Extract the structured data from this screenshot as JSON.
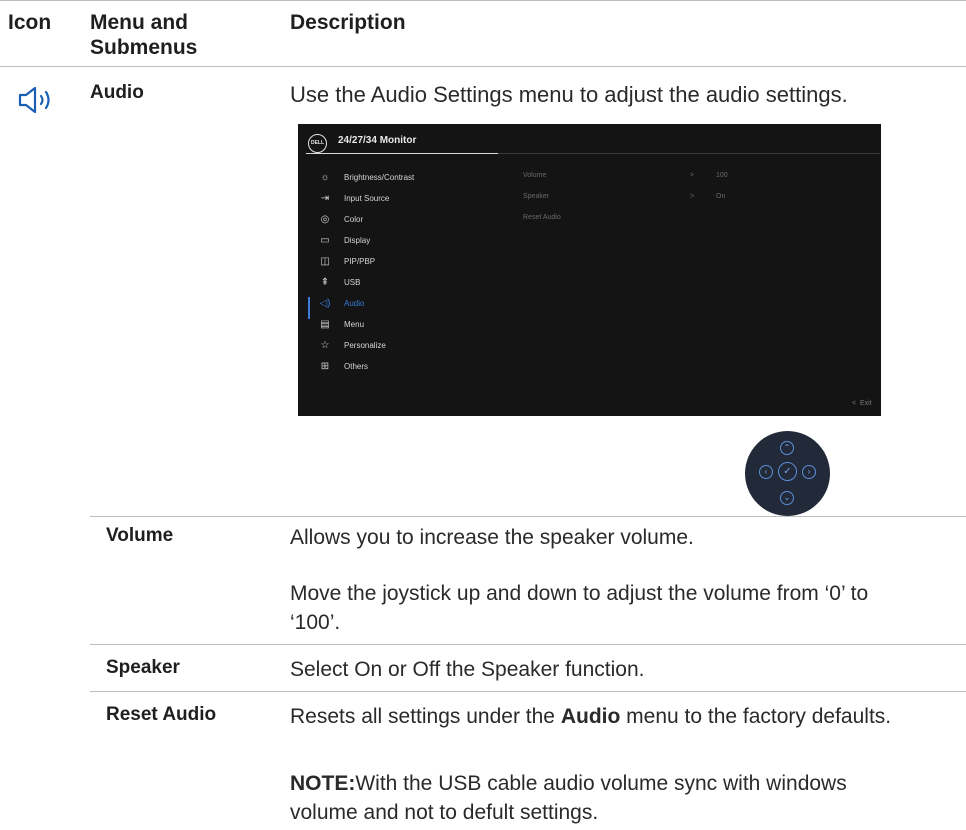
{
  "header": {
    "col_icon": "Icon",
    "col_menu_line1": "Menu and",
    "col_menu_line2": "Submenus",
    "col_desc": "Description"
  },
  "audio_row": {
    "menu_label": "Audio",
    "description": "Use the Audio Settings menu to adjust the audio settings."
  },
  "osd": {
    "logo_text": "DELL",
    "title": "24/27/34 Monitor",
    "menu_items": [
      {
        "label": "Brightness/Contrast",
        "icon": "brightness-icon"
      },
      {
        "label": "Input Source",
        "icon": "input-source-icon"
      },
      {
        "label": "Color",
        "icon": "color-icon"
      },
      {
        "label": "Display",
        "icon": "display-icon"
      },
      {
        "label": "PIP/PBP",
        "icon": "pip-pbp-icon"
      },
      {
        "label": "USB",
        "icon": "usb-icon"
      },
      {
        "label": "Audio",
        "icon": "audio-icon"
      },
      {
        "label": "Menu",
        "icon": "menu-icon"
      },
      {
        "label": "Personalize",
        "icon": "star-icon"
      },
      {
        "label": "Others",
        "icon": "others-icon"
      }
    ],
    "active_item": "Audio",
    "sub_items": [
      {
        "label": "Volume",
        "arrow": ">",
        "value": "100"
      },
      {
        "label": "Speaker",
        "arrow": ">",
        "value": "On"
      },
      {
        "label": "Reset Audio",
        "arrow": "",
        "value": ""
      }
    ],
    "exit_label": "Exit",
    "exit_arrow": "<",
    "accent_color": "#3a7bd5"
  },
  "joystick": {
    "icons": [
      "up-arrow-icon",
      "left-arrow-icon",
      "check-icon",
      "right-arrow-icon",
      "down-arrow-icon"
    ]
  },
  "submenus": {
    "volume": {
      "label": "Volume",
      "desc1": "Allows you to increase the speaker volume.",
      "desc2": "Move the joystick up and down to adjust the volume from ‘0’ to ‘100’."
    },
    "speaker": {
      "label": "Speaker",
      "desc": "Select On or Off the Speaker function."
    },
    "reset_audio": {
      "label": "Reset Audio",
      "desc_prefix": "Resets all settings under the ",
      "desc_bold": "Audio",
      "desc_suffix": " menu to the factory defaults.",
      "note_label": "NOTE:",
      "note_text": "With the USB cable audio volume sync with windows volume and not to defult settings."
    }
  }
}
